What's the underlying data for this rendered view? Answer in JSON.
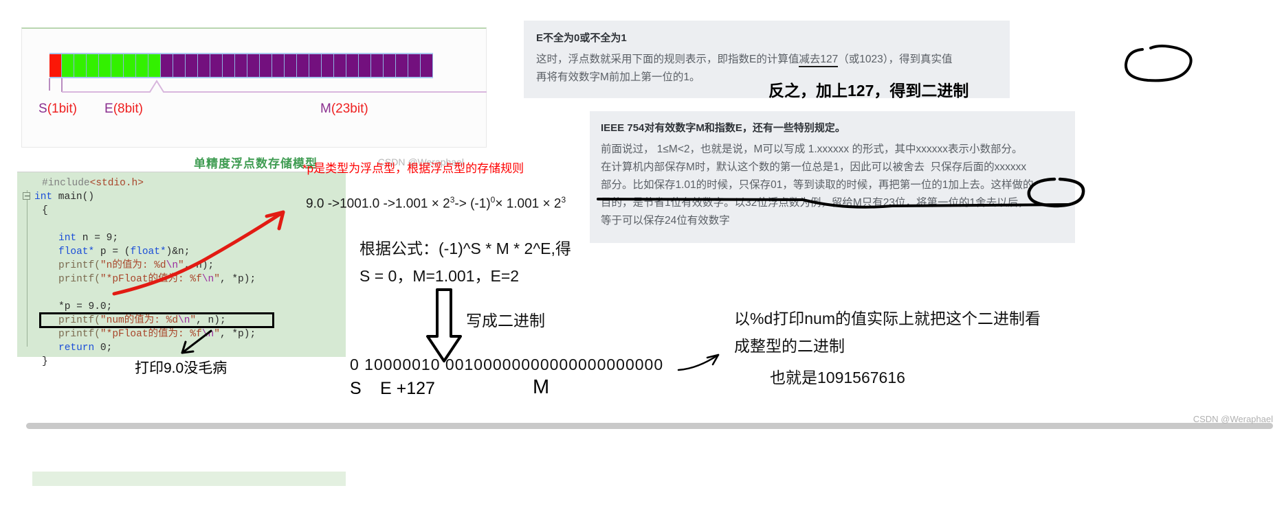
{
  "diagram": {
    "title": "单精度浮点数存储模型",
    "watermark": "CSDN @Weraphael",
    "labels": {
      "s_name": "S",
      "s_bits": "(1bit)",
      "e_name": "E",
      "e_bits": "(8bit)",
      "m_name": "M",
      "m_bits": "(23bit)"
    },
    "bits": {
      "sign": 1,
      "exponent": 8,
      "mantissa": 23
    },
    "colors": {
      "sign": "#fb1707",
      "exponent": "#33f000",
      "mantissa": "#73107e"
    }
  },
  "info_box_1": {
    "title": "E不全为0或不全为1",
    "line1_a": "这时，浮点数就采用下面的规则表示，即指数E的计算值",
    "line1_underlined": "减去127",
    "line1_b": "（或1023），得到真实值",
    "line2": "再将有效数字M前加上第一位的1。"
  },
  "info_box_2": {
    "title": "IEEE 754对有效数字M和指数E，还有一些特别规定。",
    "line1": "前面说过， 1≤M<2，也就是说，M可以写成 1.xxxxxx 的形式，其中xxxxxx表示小数部分。",
    "line2_underlined": "在计算机内部保存M时，默认这个数的第一位总是1，因此可以被舍去",
    "line2_rest": "只保存后面的xxxxxx",
    "line3": "部分。比如保存1.01的时候，只保存01，等到读取的时候，再把第一位的1加上去。这样做的",
    "line4": "目的，是节省1位有效数字。以32位浮点数为例，留给M只有23位，将第一位的1舍去以后，",
    "line5": "等于可以保存24位有效数字"
  },
  "handwriting": {
    "note_reverse": "反之，加上127，得到二进制",
    "circled_1": "得到真实值",
    "circled_2": "被舍去"
  },
  "code": {
    "lines": [
      {
        "text": "#include<stdio.h>",
        "kind": "include"
      },
      {
        "text": "int main()",
        "kind": "signature"
      },
      {
        "text": "{",
        "kind": "plain"
      },
      {
        "text": "int n = 9;",
        "kind": "decl-int"
      },
      {
        "text": "float* p = (float*)&n;",
        "kind": "decl-float"
      },
      {
        "text": "printf(\"n的值为: %d\\n\", n);",
        "kind": "printf"
      },
      {
        "text": "printf(\"*pFloat的值为: %f\\n\", *p);",
        "kind": "printf"
      },
      {
        "text": "*p = 9.0;",
        "kind": "assign"
      },
      {
        "text": "printf(\"num的值为: %d\\n\", n);",
        "kind": "printf"
      },
      {
        "text": "printf(\"*pFloat的值为: %f\\n\", *p);",
        "kind": "printf-boxed"
      },
      {
        "text": "return 0;",
        "kind": "return"
      },
      {
        "text": "}",
        "kind": "plain"
      }
    ],
    "tokens": {
      "include_hash": "#include",
      "include_file": "<stdio.h>",
      "kw_int": "int",
      "main": " main()",
      "brace_open": "{",
      "brace_close": "}",
      "int_decl": " n = 9;",
      "kw_float": "float*",
      "float_decl_a": " p = (",
      "float_decl_b": "float*",
      "float_decl_c": ")&n;",
      "printf": "printf(",
      "str_n": "\"n的值为: %d",
      "esc_n": "\\n",
      "str_close": "\"",
      "arg_n": ", n);",
      "str_pfloat": "\"*pFloat的值为: %f",
      "arg_p": ", *p);",
      "assign": "*p = 9.0;",
      "str_num": "\"num的值为: %d",
      "kw_return": "return",
      "return_val": " 0;"
    },
    "caption": "打印9.0没毛病"
  },
  "math": {
    "red_note": "*p是类型为浮点型，根据浮点型的存储规则",
    "expr": {
      "a": "9.0 ->1001.0 ->1.001 × 2",
      "a_sup": "3",
      "b": "-> (-1)",
      "b_sup": "0",
      "c": "× 1.001 × 2",
      "c_sup": "3"
    },
    "formula_1": "根据公式：(-1)^S * M * 2^E,得",
    "formula_2": "S = 0，M=1.001，E=2",
    "caption_binary": "写成二进制",
    "bits_line": "0  10000010   00100000000000000000000",
    "label_s": "S",
    "label_e127": "E +127",
    "label_m": "M"
  },
  "right_notes": {
    "line1": "以%d打印num的值实际上就把这个二进制看",
    "line2": "成整型的二进制",
    "line3": "也就是1091567616"
  },
  "footer": {
    "watermark": "CSDN @Weraphael"
  }
}
